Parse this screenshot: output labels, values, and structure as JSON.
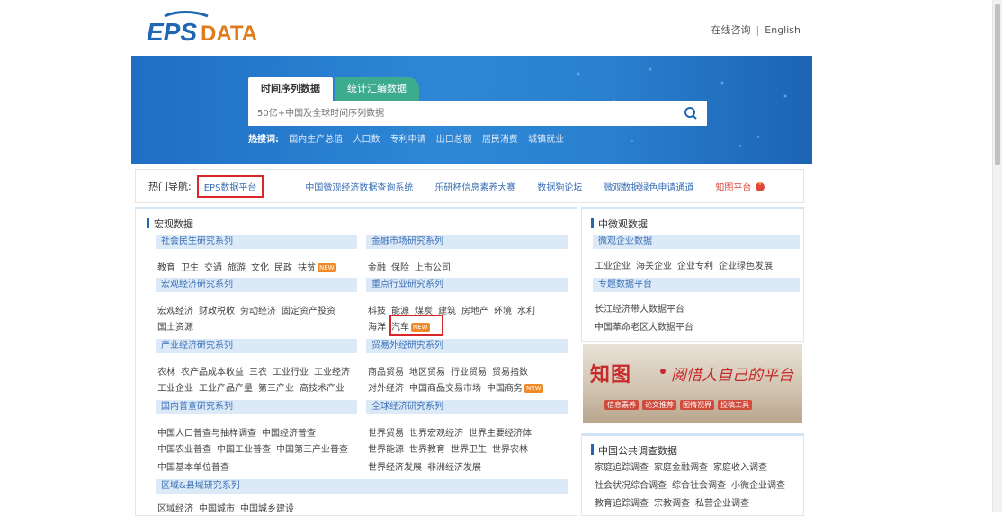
{
  "header": {
    "logo_text": "EPS DATA",
    "links": [
      "在线咨询",
      "English"
    ],
    "separator": "|"
  },
  "search": {
    "tabs": [
      "时间序列数据",
      "统计汇编数据"
    ],
    "placeholder": "50亿+中国及全球时间序列数据",
    "hot_label": "热搜词:",
    "hot_words": [
      "国内生产总值",
      "人口数",
      "专利申请",
      "出口总额",
      "居民消费",
      "城镇就业"
    ]
  },
  "hotnav": {
    "label": "热门导航:",
    "links": [
      "EPS数据平台",
      "中国微观经济数据查询系统",
      "乐研杯信息素养大赛",
      "数据狗论坛",
      "微观数据绿色申请通道",
      "知图平台"
    ]
  },
  "macro": {
    "title": "宏观数据",
    "sections": [
      {
        "name": "社会民生研究系列",
        "items": [
          "教育",
          "卫生",
          "交通",
          "旅游",
          "文化",
          "民政",
          "扶贫"
        ],
        "new_after": "扶贫"
      },
      {
        "name": "金融市场研究系列",
        "items": [
          "金融",
          "保险",
          "上市公司"
        ]
      },
      {
        "name": "宏观经济研究系列",
        "items": [
          "宏观经济",
          "财政税收",
          "劳动经济",
          "固定资产投资"
        ],
        "items2": [
          "国土资源"
        ]
      },
      {
        "name": "重点行业研究系列",
        "items": [
          "科技",
          "能源",
          "煤炭",
          "建筑",
          "房地产",
          "环境",
          "水利"
        ],
        "items2": [
          "海洋",
          "汽车"
        ],
        "new_after": "汽车"
      },
      {
        "name": "产业经济研究系列",
        "items": [
          "农林",
          "农产品成本收益",
          "三农",
          "工业行业",
          "工业经济"
        ],
        "items2": [
          "工业企业",
          "工业产品产量",
          "第三产业",
          "高技术产业"
        ]
      },
      {
        "name": "贸易外经研究系列",
        "items": [
          "商品贸易",
          "地区贸易",
          "行业贸易",
          "贸易指数"
        ],
        "items2": [
          "对外经济",
          "中国商品交易市场",
          "中国商务"
        ],
        "new_after": "中国商务"
      },
      {
        "name": "国内普查研究系列",
        "items": [
          "中国人口普查与抽样调查",
          "中国经济普查"
        ],
        "items2": [
          "中国农业普查",
          "中国工业普查",
          "中国第三产业普查"
        ],
        "items3": [
          "中国基本单位普查"
        ]
      },
      {
        "name": "全球经济研究系列",
        "items": [
          "世界贸易",
          "世界宏观经济",
          "世界主要经济体"
        ],
        "items2": [
          "世界能源",
          "世界教育",
          "世界卫生",
          "世界农林"
        ],
        "items3": [
          "世界经济发展",
          "非洲经济发展"
        ]
      },
      {
        "name": "区域&县域研究系列",
        "items": [
          "区域经济",
          "中国城市",
          "中国城乡建设"
        ]
      }
    ]
  },
  "micro": {
    "title": "中微观数据",
    "sections": [
      {
        "name": "微观企业数据",
        "items": [
          "工业企业",
          "海关企业",
          "企业专利",
          "企业绿色发展"
        ]
      },
      {
        "name": "专题数据平台",
        "items": [
          "长江经济带大数据平台"
        ],
        "items2": [
          "中国革命老区大数据平台"
        ]
      }
    ]
  },
  "ad": {
    "brand": "知图",
    "slogan": "阅惜人自己的平台",
    "tags": [
      "信息素养",
      "论文推荐",
      "图情视界",
      "投稿工具"
    ]
  },
  "survey": {
    "title": "中国公共调查数据",
    "rows": [
      [
        "家庭追踪调查",
        "家庭金融调查",
        "家庭收入调查"
      ],
      [
        "社会状况综合调查",
        "综合社会调查",
        "小微企业调查"
      ],
      [
        "教育追踪调查",
        "宗教调查",
        "私营企业调查"
      ]
    ]
  },
  "badge_text": "NEW",
  "colors": {
    "accent": "#1f66b3",
    "highlight": "#d9262b",
    "teal_tab": "#3dab8e"
  }
}
